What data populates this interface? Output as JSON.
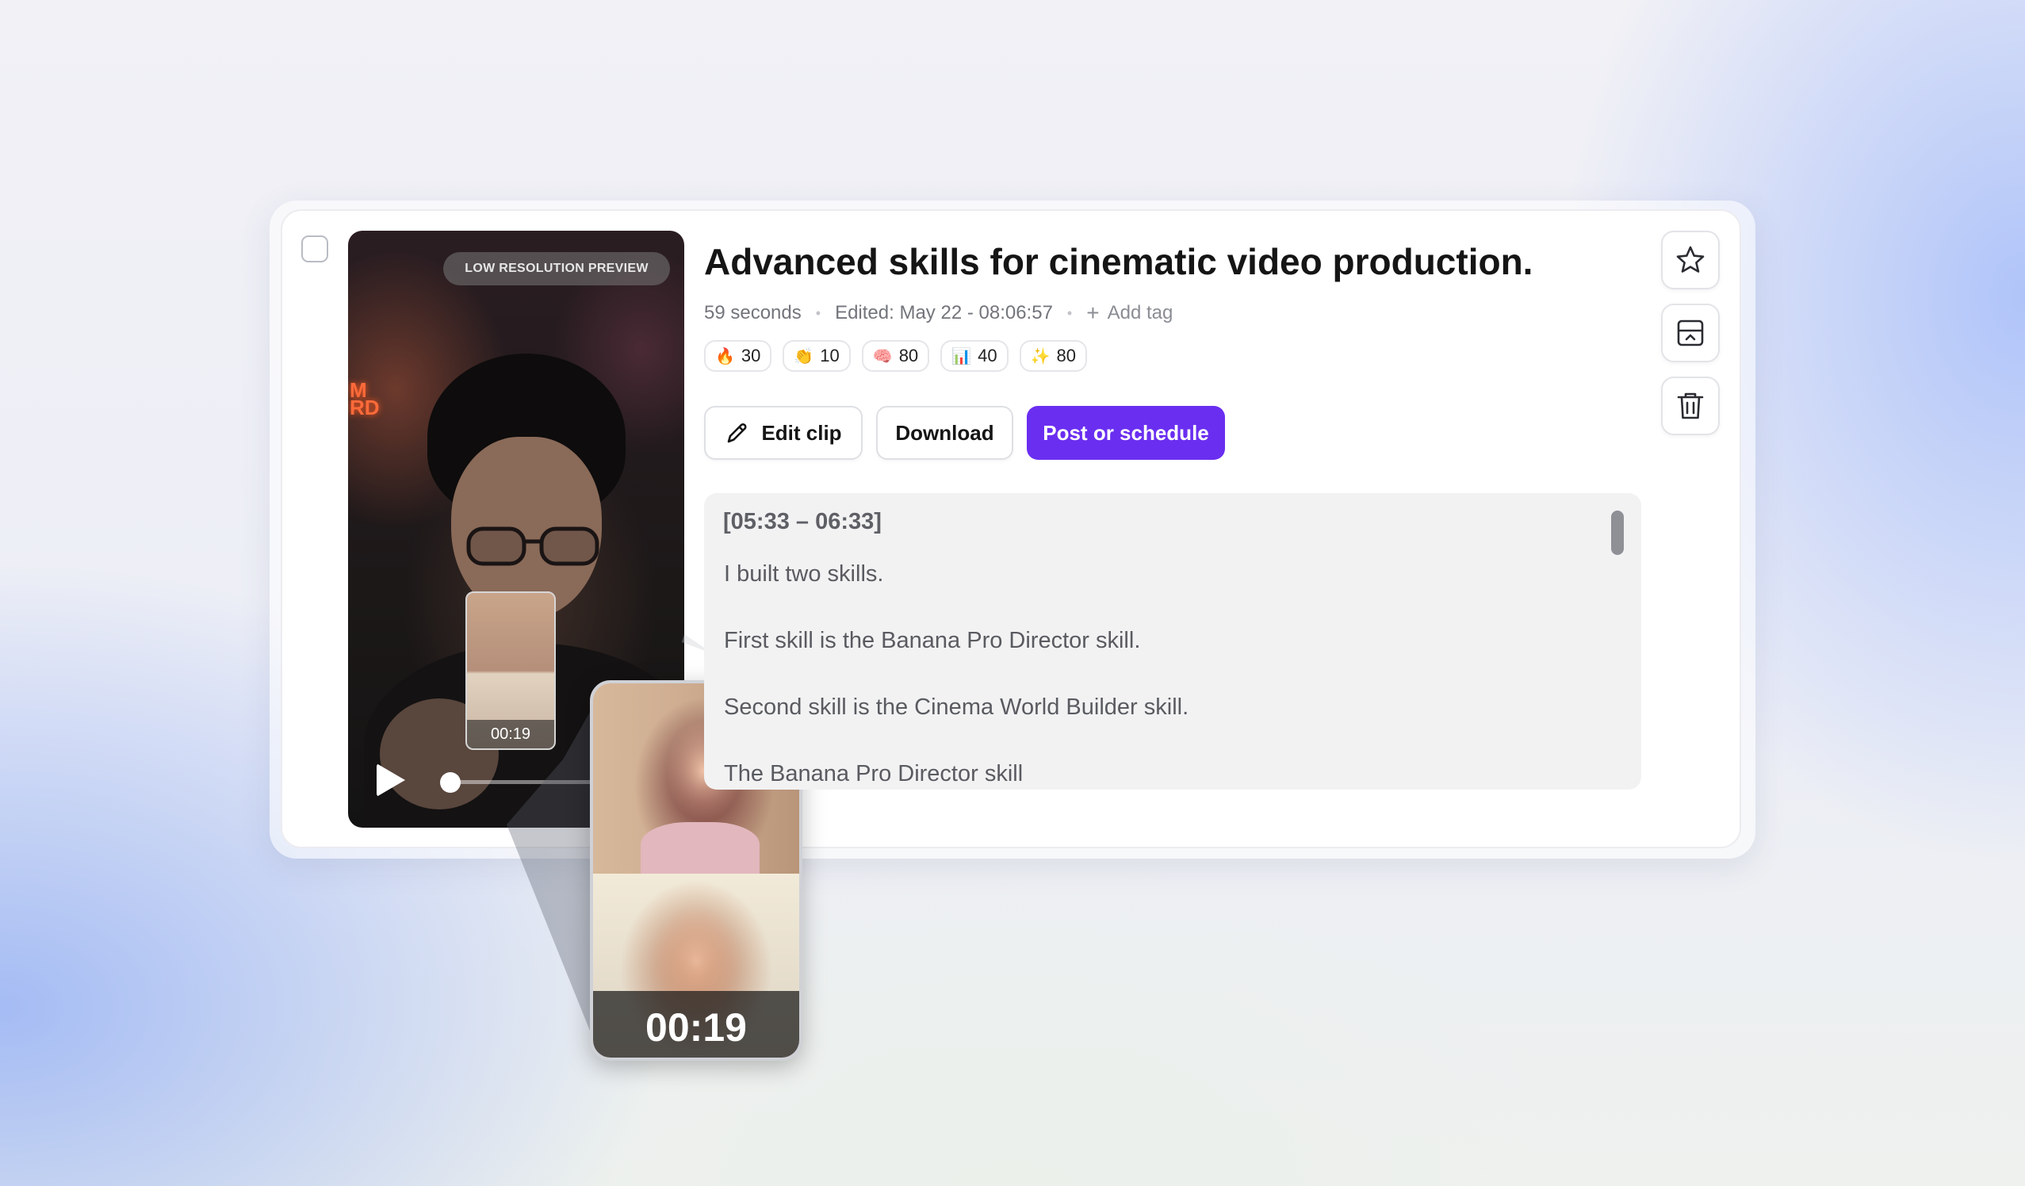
{
  "clip": {
    "title": "Advanced skills for cinematic video production.",
    "duration": "59 seconds",
    "edited": "Edited: May 22 - 08:06:57",
    "add_tag_label": "Add tag"
  },
  "preview": {
    "badge": "LOW RESOLUTION PREVIEW",
    "thumb_time": "00:19",
    "zoom_time": "00:19"
  },
  "scores": [
    {
      "emoji": "🔥",
      "value": "30"
    },
    {
      "emoji": "👏",
      "value": "10"
    },
    {
      "emoji": "🧠",
      "value": "80"
    },
    {
      "emoji": "📊",
      "value": "40"
    },
    {
      "emoji": "✨",
      "value": "80"
    }
  ],
  "actions": {
    "edit_label": "Edit clip",
    "download_label": "Download",
    "post_label": "Post or schedule"
  },
  "transcript": {
    "time_range": "[05:33 – 06:33]",
    "lines": [
      "I built two skills.",
      "First skill is the Banana Pro Director skill.",
      "Second skill is the Cinema World Builder skill.",
      "The Banana Pro Director skill"
    ]
  },
  "colors": {
    "accent": "#6a2ef0"
  },
  "icons": {
    "star": "star-icon",
    "archive": "archive-icon",
    "delete": "trash-icon",
    "edit": "pencil-icon",
    "play": "play-icon"
  }
}
